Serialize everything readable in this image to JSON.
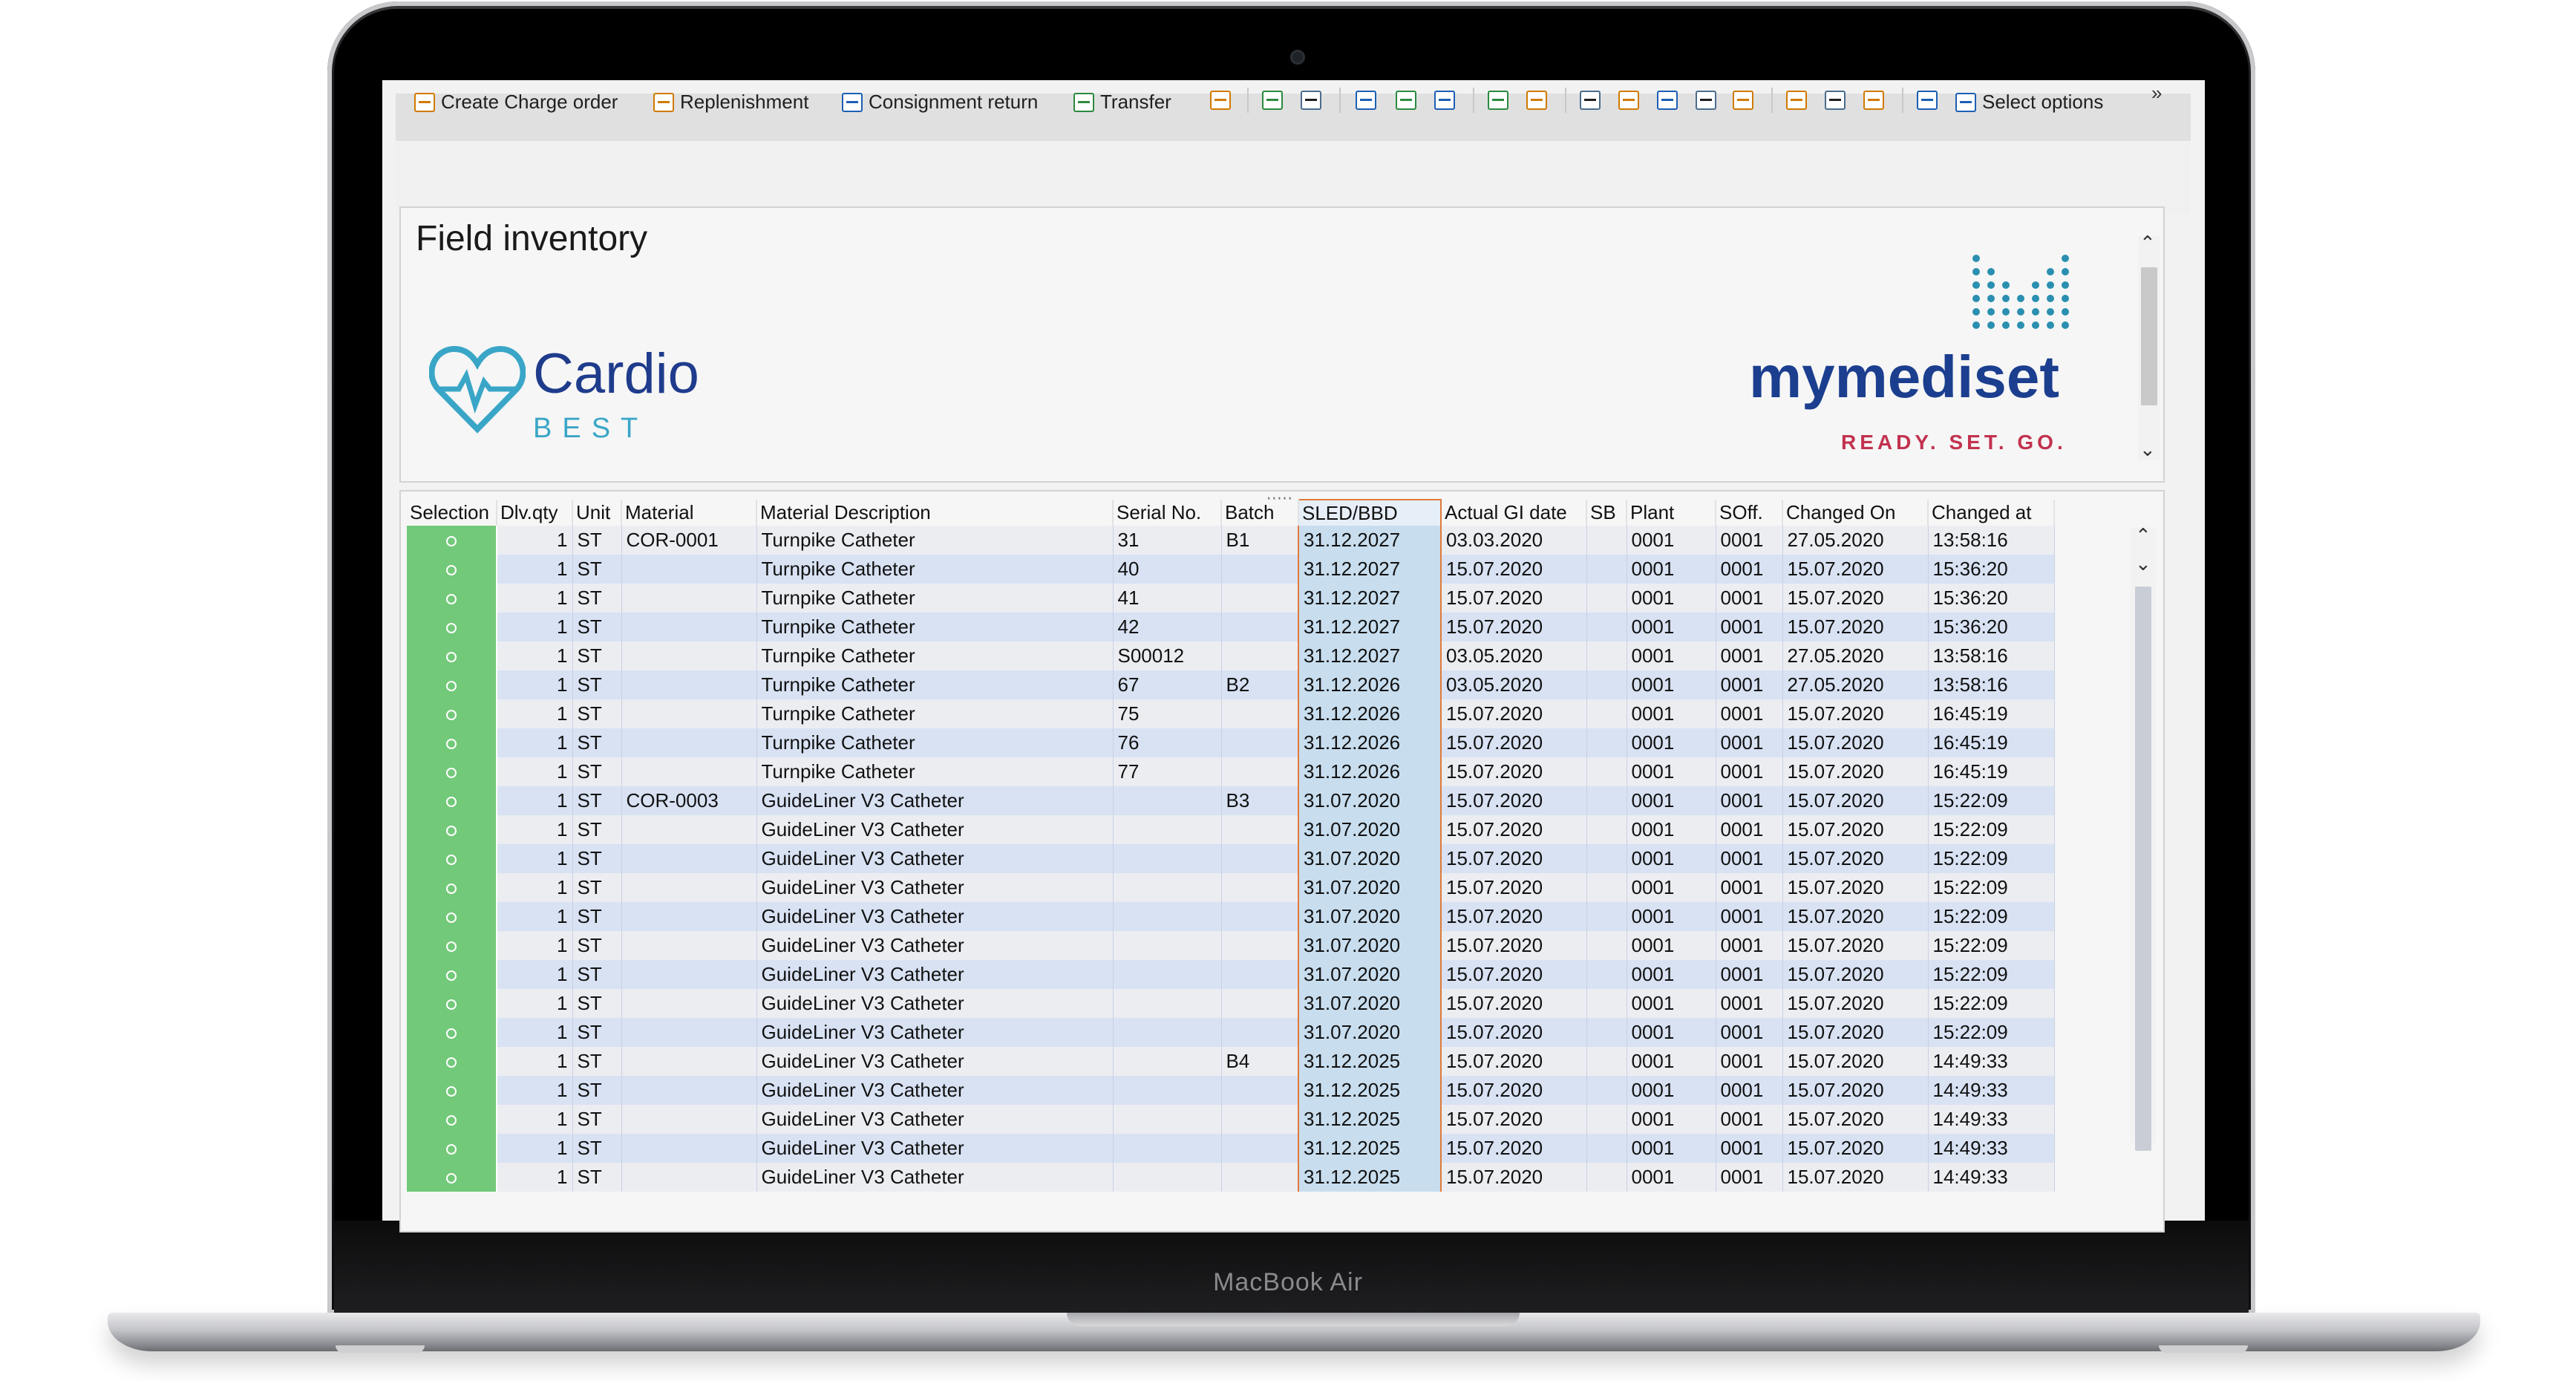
{
  "device": {
    "label": "MacBook Air"
  },
  "toolbar": {
    "create_charge_order": "Create Charge order",
    "replenishment": "Replenishment",
    "consignment_return": "Consignment return",
    "transfer": "Transfer",
    "select_options": "Select options",
    "more": "»"
  },
  "header": {
    "title": "Field inventory",
    "cardio_logo_name": "Cardio",
    "cardio_logo_sub": "BEST",
    "mediset_logo_name": "mymediset",
    "mediset_tagline": "READY. SET. GO."
  },
  "grid": {
    "columns": [
      "Selection",
      "Dlv.qty",
      "Unit",
      "Material",
      "Material Description",
      "Serial No.",
      "Batch",
      "SLED/BBD",
      "Actual GI date",
      "SB",
      "Plant",
      "SOff.",
      "Changed On",
      "Changed at"
    ],
    "rows": [
      [
        "1",
        "ST",
        "COR-0001",
        "Turnpike Catheter",
        "31",
        "B1",
        "31.12.2027",
        "03.03.2020",
        "",
        "0001",
        "0001",
        "27.05.2020",
        "13:58:16"
      ],
      [
        "1",
        "ST",
        "",
        "Turnpike Catheter",
        "40",
        "",
        "31.12.2027",
        "15.07.2020",
        "",
        "0001",
        "0001",
        "15.07.2020",
        "15:36:20"
      ],
      [
        "1",
        "ST",
        "",
        "Turnpike Catheter",
        "41",
        "",
        "31.12.2027",
        "15.07.2020",
        "",
        "0001",
        "0001",
        "15.07.2020",
        "15:36:20"
      ],
      [
        "1",
        "ST",
        "",
        "Turnpike Catheter",
        "42",
        "",
        "31.12.2027",
        "15.07.2020",
        "",
        "0001",
        "0001",
        "15.07.2020",
        "15:36:20"
      ],
      [
        "1",
        "ST",
        "",
        "Turnpike Catheter",
        "S00012",
        "",
        "31.12.2027",
        "03.05.2020",
        "",
        "0001",
        "0001",
        "27.05.2020",
        "13:58:16"
      ],
      [
        "1",
        "ST",
        "",
        "Turnpike Catheter",
        "67",
        "B2",
        "31.12.2026",
        "03.05.2020",
        "",
        "0001",
        "0001",
        "27.05.2020",
        "13:58:16"
      ],
      [
        "1",
        "ST",
        "",
        "Turnpike Catheter",
        "75",
        "",
        "31.12.2026",
        "15.07.2020",
        "",
        "0001",
        "0001",
        "15.07.2020",
        "16:45:19"
      ],
      [
        "1",
        "ST",
        "",
        "Turnpike Catheter",
        "76",
        "",
        "31.12.2026",
        "15.07.2020",
        "",
        "0001",
        "0001",
        "15.07.2020",
        "16:45:19"
      ],
      [
        "1",
        "ST",
        "",
        "Turnpike Catheter",
        "77",
        "",
        "31.12.2026",
        "15.07.2020",
        "",
        "0001",
        "0001",
        "15.07.2020",
        "16:45:19"
      ],
      [
        "1",
        "ST",
        "COR-0003",
        "GuideLiner V3 Catheter",
        "",
        "B3",
        "31.07.2020",
        "15.07.2020",
        "",
        "0001",
        "0001",
        "15.07.2020",
        "15:22:09"
      ],
      [
        "1",
        "ST",
        "",
        "GuideLiner V3 Catheter",
        "",
        "",
        "31.07.2020",
        "15.07.2020",
        "",
        "0001",
        "0001",
        "15.07.2020",
        "15:22:09"
      ],
      [
        "1",
        "ST",
        "",
        "GuideLiner V3 Catheter",
        "",
        "",
        "31.07.2020",
        "15.07.2020",
        "",
        "0001",
        "0001",
        "15.07.2020",
        "15:22:09"
      ],
      [
        "1",
        "ST",
        "",
        "GuideLiner V3 Catheter",
        "",
        "",
        "31.07.2020",
        "15.07.2020",
        "",
        "0001",
        "0001",
        "15.07.2020",
        "15:22:09"
      ],
      [
        "1",
        "ST",
        "",
        "GuideLiner V3 Catheter",
        "",
        "",
        "31.07.2020",
        "15.07.2020",
        "",
        "0001",
        "0001",
        "15.07.2020",
        "15:22:09"
      ],
      [
        "1",
        "ST",
        "",
        "GuideLiner V3 Catheter",
        "",
        "",
        "31.07.2020",
        "15.07.2020",
        "",
        "0001",
        "0001",
        "15.07.2020",
        "15:22:09"
      ],
      [
        "1",
        "ST",
        "",
        "GuideLiner V3 Catheter",
        "",
        "",
        "31.07.2020",
        "15.07.2020",
        "",
        "0001",
        "0001",
        "15.07.2020",
        "15:22:09"
      ],
      [
        "1",
        "ST",
        "",
        "GuideLiner V3 Catheter",
        "",
        "",
        "31.07.2020",
        "15.07.2020",
        "",
        "0001",
        "0001",
        "15.07.2020",
        "15:22:09"
      ],
      [
        "1",
        "ST",
        "",
        "GuideLiner V3 Catheter",
        "",
        "",
        "31.07.2020",
        "15.07.2020",
        "",
        "0001",
        "0001",
        "15.07.2020",
        "15:22:09"
      ],
      [
        "1",
        "ST",
        "",
        "GuideLiner V3 Catheter",
        "",
        "B4",
        "31.12.2025",
        "15.07.2020",
        "",
        "0001",
        "0001",
        "15.07.2020",
        "14:49:33"
      ],
      [
        "1",
        "ST",
        "",
        "GuideLiner V3 Catheter",
        "",
        "",
        "31.12.2025",
        "15.07.2020",
        "",
        "0001",
        "0001",
        "15.07.2020",
        "14:49:33"
      ],
      [
        "1",
        "ST",
        "",
        "GuideLiner V3 Catheter",
        "",
        "",
        "31.12.2025",
        "15.07.2020",
        "",
        "0001",
        "0001",
        "15.07.2020",
        "14:49:33"
      ],
      [
        "1",
        "ST",
        "",
        "GuideLiner V3 Catheter",
        "",
        "",
        "31.12.2025",
        "15.07.2020",
        "",
        "0001",
        "0001",
        "15.07.2020",
        "14:49:33"
      ],
      [
        "1",
        "ST",
        "",
        "GuideLiner V3 Catheter",
        "",
        "",
        "31.12.2025",
        "15.07.2020",
        "",
        "0001",
        "0001",
        "15.07.2020",
        "14:49:33"
      ]
    ]
  },
  "colors": {
    "selection_green": "#72c979",
    "row_alt_blue": "#d8e2f3",
    "sled_column": "#c8deef",
    "cardio_blue": "#1f3c8c",
    "cardio_teal": "#3aa6c7",
    "mediset_blue": "#1b3e8f",
    "mediset_red": "#c2324f"
  }
}
